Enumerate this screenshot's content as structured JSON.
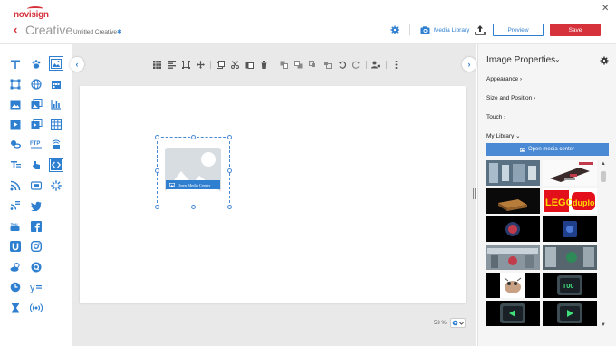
{
  "header": {
    "logo_text": "novisign",
    "app_title": "Creative",
    "creative_name": "Untitled Creative",
    "unsaved_marker": "✱",
    "media_library_label": "Media Library",
    "preview_label": "Preview",
    "save_label": "Save",
    "close_glyph": "✕"
  },
  "canvas": {
    "open_media_label": "Open Media Center",
    "zoom_value": "53 %"
  },
  "right_panel": {
    "title": "Image Properties",
    "sections": {
      "appearance": "Appearance",
      "size_position": "Size and Position",
      "touch": "Touch",
      "my_library": "My Library"
    },
    "open_media_center_label": "Open media center",
    "thumbnails": [
      "Lobby photo",
      "Product photo with caption",
      "Wooden crate product",
      "LEGO duplo logo",
      "Red circle on dark",
      "Blue disc on dark",
      "Store entrance",
      "Interior scene",
      "Cartoon cow",
      "TOC button",
      "Left arrow button",
      "Right arrow button"
    ],
    "toc_text": "TOC"
  },
  "colors": {
    "brand_red": "#d6323c",
    "accent_blue": "#2f7fd1",
    "panel_bg": "#f5f5f5",
    "canvas_bg": "#e9e9ea"
  }
}
